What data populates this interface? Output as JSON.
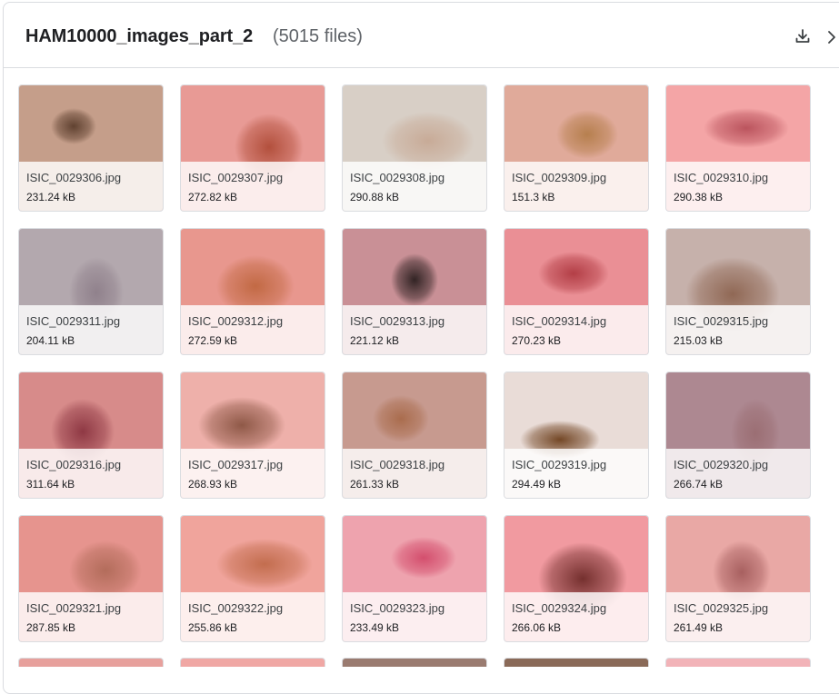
{
  "folder": {
    "name": "HAM10000_images_part_2",
    "count_label": "(5015 files)",
    "download_icon": "download-icon",
    "expand_icon": "chevron-right-icon"
  },
  "files": [
    {
      "name": "ISIC_0029306.jpg",
      "size": "231.24 kB",
      "bg": "#c59e8a",
      "spot": "#5b3d2c"
    },
    {
      "name": "ISIC_0029307.jpg",
      "size": "272.82 kB",
      "bg": "#e89a95",
      "spot": "#b04c38"
    },
    {
      "name": "ISIC_0029308.jpg",
      "size": "290.88 kB",
      "bg": "#d8cfc6",
      "spot": "#c7a995"
    },
    {
      "name": "ISIC_0029309.jpg",
      "size": "151.3 kB",
      "bg": "#e0aa9a",
      "spot": "#b47d4a"
    },
    {
      "name": "ISIC_0029310.jpg",
      "size": "290.38 kB",
      "bg": "#f4a5a6",
      "spot": "#b8505a"
    },
    {
      "name": "ISIC_0029311.jpg",
      "size": "204.11 kB",
      "bg": "#b3a8ae",
      "spot": "#8e7f8a"
    },
    {
      "name": "ISIC_0029312.jpg",
      "size": "272.59 kB",
      "bg": "#e8978e",
      "spot": "#c06740"
    },
    {
      "name": "ISIC_0029313.jpg",
      "size": "221.12 kB",
      "bg": "#c99096",
      "spot": "#2a1e1e"
    },
    {
      "name": "ISIC_0029314.jpg",
      "size": "270.23 kB",
      "bg": "#ea8f95",
      "spot": "#b03a42"
    },
    {
      "name": "ISIC_0029315.jpg",
      "size": "215.03 kB",
      "bg": "#c6b1ab",
      "spot": "#8d6450"
    },
    {
      "name": "ISIC_0029316.jpg",
      "size": "311.64 kB",
      "bg": "#d78b8a",
      "spot": "#8b3440"
    },
    {
      "name": "ISIC_0029317.jpg",
      "size": "268.93 kB",
      "bg": "#eeb0aa",
      "spot": "#8a5442"
    },
    {
      "name": "ISIC_0029318.jpg",
      "size": "261.33 kB",
      "bg": "#c79a8f",
      "spot": "#a86a4a"
    },
    {
      "name": "ISIC_0029319.jpg",
      "size": "294.49 kB",
      "bg": "#e9dcd7",
      "spot": "#6d3f1c"
    },
    {
      "name": "ISIC_0029320.jpg",
      "size": "266.74 kB",
      "bg": "#ad8891",
      "spot": "#9a6d72"
    },
    {
      "name": "ISIC_0029321.jpg",
      "size": "287.85 kB",
      "bg": "#e6948e",
      "spot": "#b06a58"
    },
    {
      "name": "ISIC_0029322.jpg",
      "size": "255.86 kB",
      "bg": "#f0a49c",
      "spot": "#c06a4a"
    },
    {
      "name": "ISIC_0029323.jpg",
      "size": "233.49 kB",
      "bg": "#eea3ae",
      "spot": "#d24a6a"
    },
    {
      "name": "ISIC_0029324.jpg",
      "size": "266.06 kB",
      "bg": "#f19aa0",
      "spot": "#6e2a28"
    },
    {
      "name": "ISIC_0029325.jpg",
      "size": "261.49 kB",
      "bg": "#e9a8a5",
      "spot": "#a45c5c"
    }
  ],
  "next_row_colors": [
    "#e7a09c",
    "#f0a7a4",
    "#9a7b70",
    "#8a6a58",
    "#f2b3b8"
  ]
}
